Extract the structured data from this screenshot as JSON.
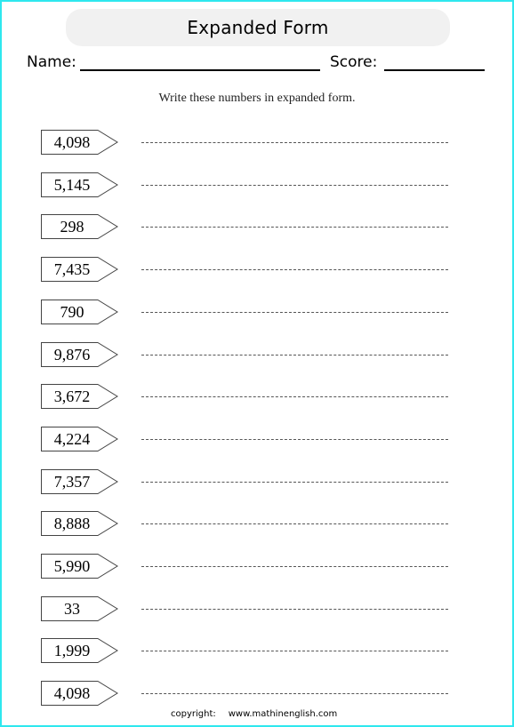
{
  "worksheet": {
    "title": "Expanded Form",
    "name_label": "Name:",
    "score_label": "Score:",
    "instruction": "Write these numbers in expanded form.",
    "border_color": "#2ee8ee",
    "problems": [
      "4,098",
      "5,145",
      "298",
      "7,435",
      "790",
      "9,876",
      "3,672",
      "4,224",
      "7,357",
      "8,888",
      "5,990",
      "33",
      "1,999",
      "4,098"
    ],
    "footer": {
      "copyright_label": "copyright:",
      "url": "www.mathinenglish.com"
    }
  }
}
